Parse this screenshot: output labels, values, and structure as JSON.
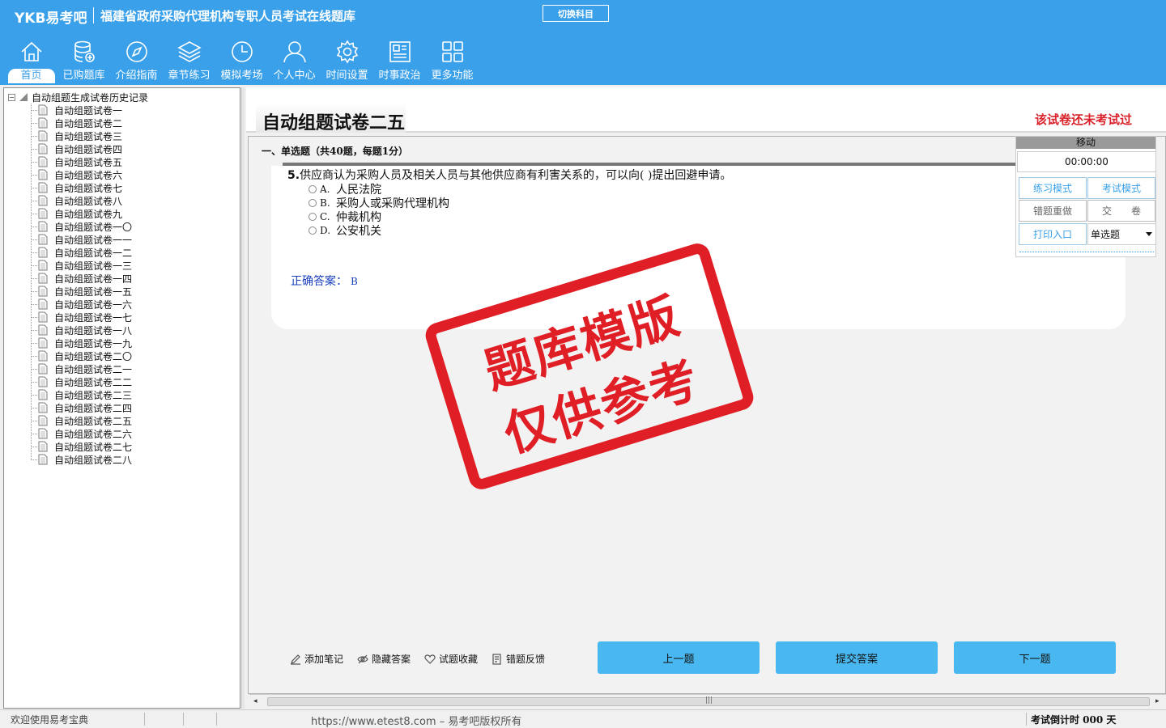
{
  "header": {
    "logo": "YKB易考吧",
    "app_title": "福建省政府采购代理机构专职人员考试在线题库",
    "switch_subject": "切换科目"
  },
  "nav": [
    {
      "label": "首页",
      "icon": "home-icon"
    },
    {
      "label": "已购题库",
      "icon": "database-icon"
    },
    {
      "label": "介绍指南",
      "icon": "compass-icon"
    },
    {
      "label": "章节练习",
      "icon": "layers-icon"
    },
    {
      "label": "模拟考场",
      "icon": "clock-icon"
    },
    {
      "label": "个人中心",
      "icon": "user-icon"
    },
    {
      "label": "时间设置",
      "icon": "gear-icon"
    },
    {
      "label": "时事政治",
      "icon": "newspaper-icon"
    },
    {
      "label": "更多功能",
      "icon": "grid-icon"
    }
  ],
  "tree": {
    "root": "自动组题生成试卷历史记录",
    "items": [
      "自动组题试卷一",
      "自动组题试卷二",
      "自动组题试卷三",
      "自动组题试卷四",
      "自动组题试卷五",
      "自动组题试卷六",
      "自动组题试卷七",
      "自动组题试卷八",
      "自动组题试卷九",
      "自动组题试卷一〇",
      "自动组题试卷一一",
      "自动组题试卷一二",
      "自动组题试卷一三",
      "自动组题试卷一四",
      "自动组题试卷一五",
      "自动组题试卷一六",
      "自动组题试卷一七",
      "自动组题试卷一八",
      "自动组题试卷一九",
      "自动组题试卷二〇",
      "自动组题试卷二一",
      "自动组题试卷二二",
      "自动组题试卷二三",
      "自动组题试卷二四",
      "自动组题试卷二五",
      "自动组题试卷二六",
      "自动组题试卷二七",
      "自动组题试卷二八"
    ]
  },
  "paper": {
    "title": "自动组题试卷二五",
    "status": "该试卷还未考试过",
    "section": "一、单选题（共40题，每题1分）"
  },
  "question": {
    "number": "5.",
    "text": "供应商认为采购人员及相关人员与其他供应商有利害关系的，可以向(   )提出回避申请。",
    "options": [
      {
        "letter": "A.",
        "text": "人民法院"
      },
      {
        "letter": "B.",
        "text": "采购人或采购代理机构"
      },
      {
        "letter": "C.",
        "text": "仲裁机构"
      },
      {
        "letter": "D.",
        "text": "公安机关"
      }
    ],
    "answer_label": "正确答案：",
    "answer_value": "B"
  },
  "stamp": {
    "line1": "题库模版",
    "line2": "仅供参考",
    "color": "#e01e25"
  },
  "float_panel": {
    "move": "移动",
    "timer": "00:00:00",
    "practice_mode": "练习模式",
    "exam_mode": "考试模式",
    "redo_wrong": "错题重做",
    "submit_paper": "交　　卷",
    "print": "打印入口",
    "type_select": "单选题"
  },
  "tools": {
    "add_note": "添加笔记",
    "hide_answer": "隐藏答案",
    "favorite": "试题收藏",
    "report_error": "错题反馈"
  },
  "buttons": {
    "prev": "上一题",
    "submit": "提交答案",
    "next": "下一题"
  },
  "statusbar": {
    "welcome": "欢迎使用易考宝典",
    "url": "https://www.etest8.com – 易考吧版权所有",
    "countdown": "考试倒计时 000 天"
  },
  "colors": {
    "accent": "#3aa0e9",
    "button": "#4ab8f0",
    "status_red": "#d9222a",
    "answer_blue": "#1a3fbf"
  }
}
